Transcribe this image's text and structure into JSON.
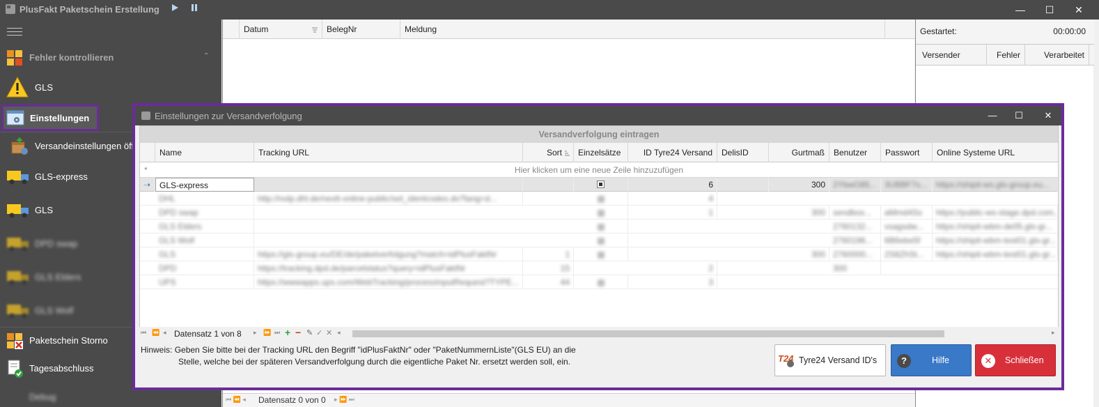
{
  "app": {
    "title": "PlusFakt Paketschein Erstellung",
    "controls": {
      "minimize": "—",
      "maximize": "☐",
      "close": "✕"
    }
  },
  "sidebar": {
    "group_label": "Fehler kontrollieren",
    "items": [
      {
        "label": "GLS",
        "icon": "warning-icon"
      },
      {
        "label": "Einstellungen",
        "icon": "settings-window-icon"
      },
      {
        "label": "Versandeinstellungen öff",
        "icon": "package-settings-icon"
      },
      {
        "label": "GLS-express",
        "icon": "truck-icon"
      },
      {
        "label": "GLS",
        "icon": "truck-icon"
      },
      {
        "label": "DPD swap",
        "icon": "truck-icon"
      },
      {
        "label": "GLS Elders",
        "icon": "truck-icon"
      },
      {
        "label": "GLS Wolf",
        "icon": "truck-icon"
      },
      {
        "label": "Paketschein Storno",
        "icon": "cancel-label-icon"
      },
      {
        "label": "Tagesabschluss",
        "icon": "checklist-icon"
      },
      {
        "label": "Debug",
        "icon": "none"
      }
    ]
  },
  "main_grid": {
    "columns": [
      "Datum",
      "BelegNr",
      "Meldung"
    ],
    "record_nav": "Datensatz 0 von 0"
  },
  "right_panel": {
    "started_label": "Gestartet:",
    "started_value": "00:00:00",
    "columns": [
      "Versender",
      "Fehler",
      "Verarbeitet"
    ]
  },
  "dialog": {
    "title": "Einstellungen zur Versandverfolgung",
    "caption": "Versandverfolgung eintragen",
    "columns": [
      "Name",
      "Tracking URL",
      "Sort",
      "Einzelsätze",
      "ID Tyre24 Versand",
      "DelisID",
      "Gurtmaß",
      "Benutzer",
      "Passwort",
      "Online Systeme URL"
    ],
    "new_row_text": "Hier klicken um eine neue Zeile hinzuzufügen",
    "rows": [
      {
        "name": "GLS-express",
        "url": "",
        "sort": "",
        "einzel": true,
        "tyre": "6",
        "delis": "",
        "gurt": "300",
        "benutzer": "2YbwO85...",
        "passwort": "3UBBF7s...",
        "online": "https://shipit-ws.gls-group.eu..."
      },
      {
        "name": "DHL",
        "url": "http://nolp.dhl.de/nextt-online-public/set_identcodes.do?lang=d...",
        "sort": "",
        "einzel": true,
        "tyre": "4",
        "delis": "",
        "gurt": "",
        "benutzer": "",
        "passwort": "",
        "online": ""
      },
      {
        "name": "DPD swap",
        "url": "",
        "sort": "",
        "einzel": true,
        "tyre": "1",
        "delis": "",
        "gurt": "300",
        "benutzer": "sendbox...",
        "passwort": "aMmd4Ss",
        "online": "https://public-ws-stage.dpd.com..."
      },
      {
        "name": "GLS Elders",
        "url": "",
        "sort": "",
        "einzel": true,
        "tyre": "",
        "delis": "",
        "gurt": "",
        "benutzer": "2760132...",
        "passwort": "vsagsdw...",
        "online": "https://shipit-wbm-de05.gls-gr..."
      },
      {
        "name": "GLS Wolf",
        "url": "",
        "sort": "",
        "einzel": true,
        "tyre": "",
        "delis": "",
        "gurt": "",
        "benutzer": "2760196...",
        "passwort": "6B6ebe5f",
        "online": "https://shipit-wbm-test01.gls-gr..."
      },
      {
        "name": "GLS",
        "url": "https://gls-group.eu/DE/de/paketverfolgung?match=idPlusFaktNr",
        "sort": "1",
        "einzel": true,
        "tyre": "",
        "delis": "",
        "gurt": "300",
        "benutzer": "2760000...",
        "passwort": "2S8ZhSt...",
        "online": "https://shipit-wbm-test01.gls-gr..."
      },
      {
        "name": "DPD",
        "url": "https://tracking.dpd.de/parcelstatus?query=idPlusFaktNr",
        "sort": "15",
        "einzel": false,
        "tyre": "2",
        "delis": "",
        "gurt": "300",
        "benutzer": "",
        "passwort": "",
        "online": ""
      },
      {
        "name": "UPS",
        "url": "https://wwwapps.ups.com/WebTracking/processInputRequest?TYPE...",
        "sort": "44",
        "einzel": true,
        "tyre": "3",
        "delis": "",
        "gurt": "",
        "benutzer": "",
        "passwort": "",
        "online": ""
      }
    ],
    "record_nav": "Datensatz 1 von 8",
    "hint_label": "Hinweis:",
    "hint_line1": "Geben Sie bitte bei der Tracking URL den Begriff \"idPlusFaktNr\" oder \"PaketNummernListe\"(GLS EU) an die",
    "hint_line2": "Stelle, welche bei der späteren Versandverfolgung durch die eigentliche Paket Nr. ersetzt werden soll, ein.",
    "buttons": {
      "tyre": "Tyre24 Versand ID's",
      "tyre_logo": "T24",
      "help": "Hilfe",
      "close": "Schließen"
    }
  },
  "colors": {
    "accent_purple": "#6a2c9a",
    "help_blue": "#3a78c8",
    "close_red": "#d8303a",
    "dark_chrome": "#4a4a4a"
  }
}
